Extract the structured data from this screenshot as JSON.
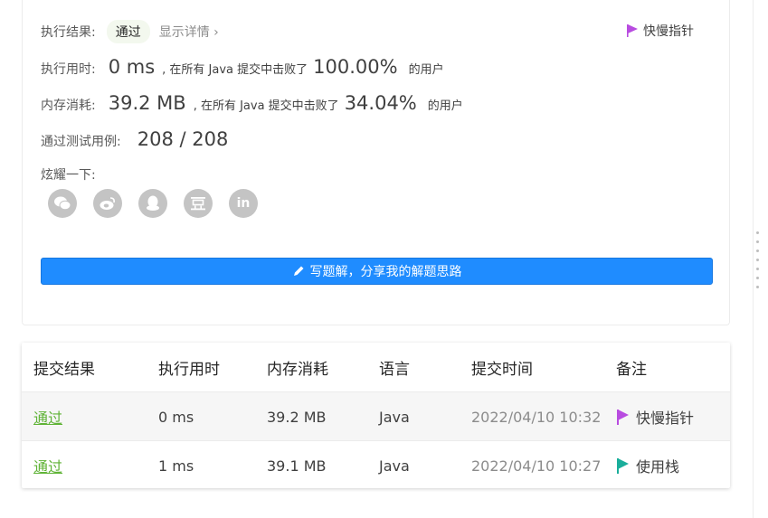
{
  "result": {
    "status_label": "执行结果:",
    "status_value": "通过",
    "details_link": "显示详情",
    "note_label": "快慢指针",
    "runtime_label": "执行用时:",
    "runtime_value": "0 ms",
    "runtime_beat_text": ", 在所有 Java 提交中击败了",
    "runtime_percent": "100.00%",
    "runtime_suffix": "的用户",
    "memory_label": "内存消耗:",
    "memory_value": "39.2 MB",
    "memory_beat_text": ", 在所有 Java 提交中击败了",
    "memory_percent": "34.04%",
    "memory_suffix": "的用户",
    "tests_label": "通过测试用例:",
    "tests_value": "208 / 208",
    "share_label": "炫耀一下:",
    "share_icons": [
      "wechat-icon",
      "weibo-icon",
      "qq-icon",
      "douban-icon",
      "linkedin-icon"
    ],
    "write_button": "写题解，分享我的解题思路"
  },
  "submissions": {
    "headers": [
      "提交结果",
      "执行用时",
      "内存消耗",
      "语言",
      "提交时间",
      "备注"
    ],
    "rows": [
      {
        "status": "通过",
        "runtime": "0 ms",
        "memory": "39.2 MB",
        "language": "Java",
        "time": "2022/04/10 10:32",
        "note": "快慢指针",
        "flag_color": "#b84ce0"
      },
      {
        "status": "通过",
        "runtime": "1 ms",
        "memory": "39.1 MB",
        "language": "Java",
        "time": "2022/04/10 10:27",
        "note": "使用栈",
        "flag_color": "#1aae9b"
      }
    ]
  },
  "colors": {
    "accent": "#1f8cff",
    "pass_green": "#5fb336",
    "flag_purple": "#b84ce0",
    "flag_teal": "#1aae9b"
  }
}
